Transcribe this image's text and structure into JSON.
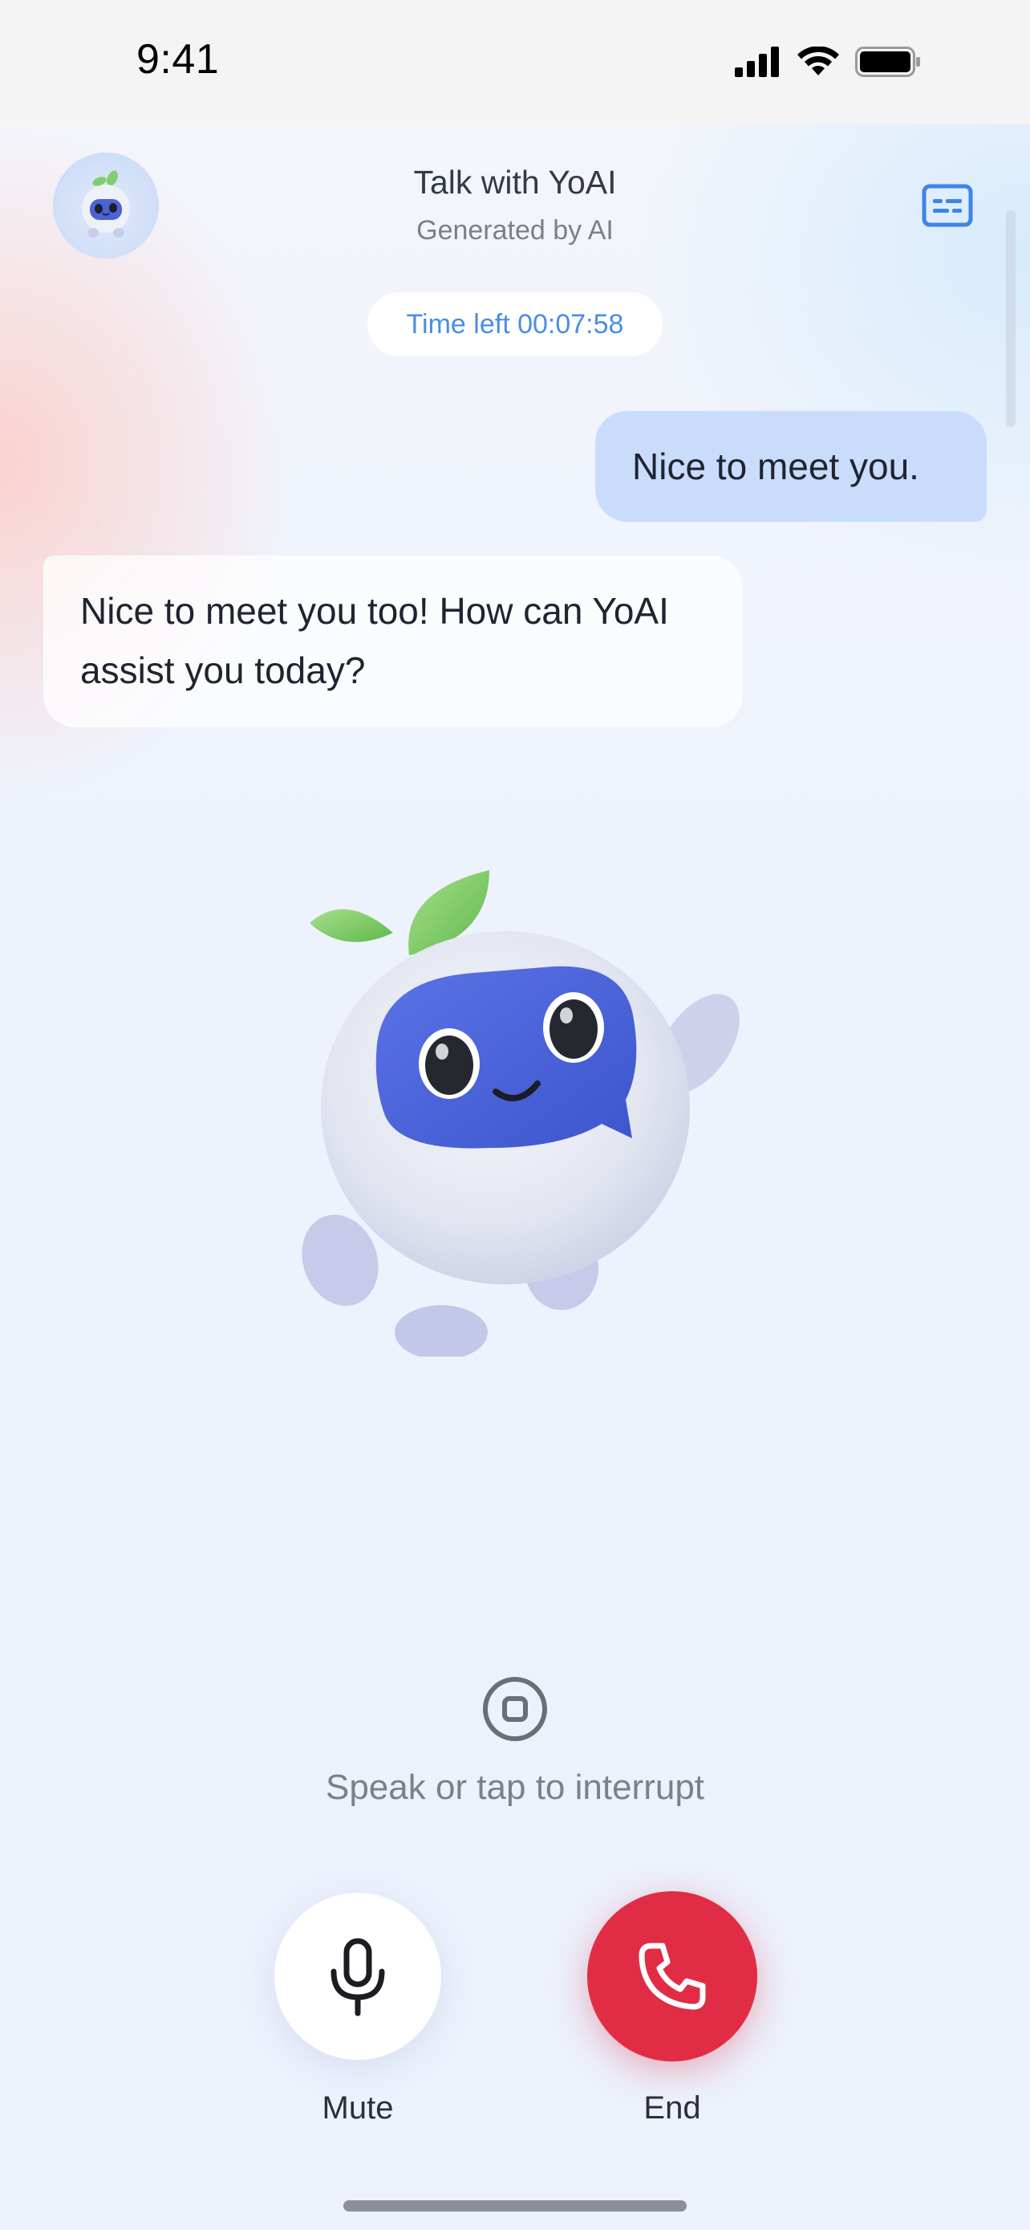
{
  "status_bar": {
    "time": "9:41",
    "icons": [
      "cellular-signal-icon",
      "wifi-icon",
      "battery-icon"
    ]
  },
  "header": {
    "title": "Talk with YoAI",
    "subtitle": "Generated by AI",
    "avatar_icon": "yoai-mascot-avatar",
    "caption_icon": "captions-icon"
  },
  "timer": {
    "text": "Time left 00:07:58"
  },
  "messages": [
    {
      "role": "user",
      "text": "Nice to meet you."
    },
    {
      "role": "assistant",
      "text": "Nice to meet you too! How can YoAI assist you today?"
    }
  ],
  "interrupt": {
    "icon": "stop-circle-icon",
    "text": "Speak or tap to interrupt"
  },
  "controls": {
    "mute_label": "Mute",
    "end_label": "End",
    "mute_icon": "microphone-icon",
    "end_icon": "phone-icon"
  },
  "colors": {
    "accent_blue": "#4a8de6",
    "user_bubble": "#c9dcfb",
    "end_red": "#e02d45",
    "leaf_green": "#7fce6a",
    "mascot_face": "#4a63d8"
  }
}
